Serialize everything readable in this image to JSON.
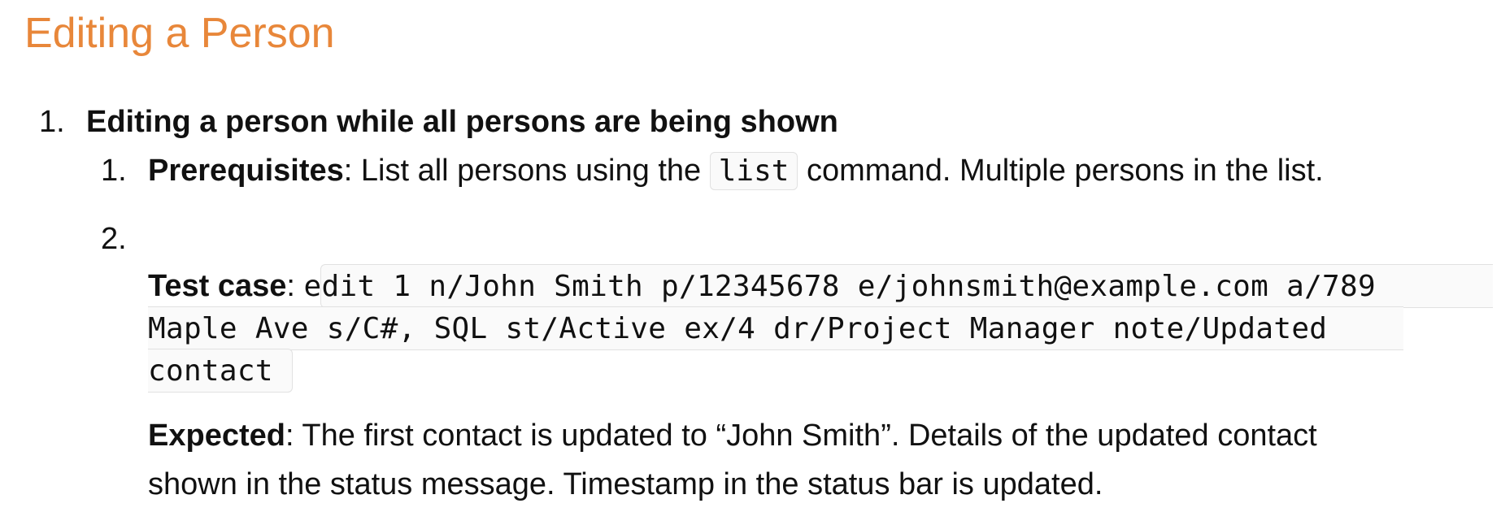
{
  "heading": "Editing a Person",
  "outer_item": {
    "number": "1.",
    "title": "Editing a person while all persons are being shown"
  },
  "items": [
    {
      "number": "1.",
      "label": "Prerequisites",
      "text_before": ": List all persons using the ",
      "code": "list",
      "text_after": " command. Multiple persons in the list."
    },
    {
      "number": "2.",
      "label": "Test case",
      "separator": ": ",
      "code_line_1": "edit 1 n/John Smith p/12345678 e/johnsmith@example.com a/789",
      "code_line_2": "Maple Ave s/C#, SQL st/Active ex/4 dr/Project Manager note/Updated",
      "code_line_3": "contact",
      "expected_label": "Expected",
      "expected_line_1": ": The first contact is updated to “John Smith”. Details of the updated contact",
      "expected_line_2": "shown in the status message. Timestamp in the status bar is updated."
    }
  ]
}
